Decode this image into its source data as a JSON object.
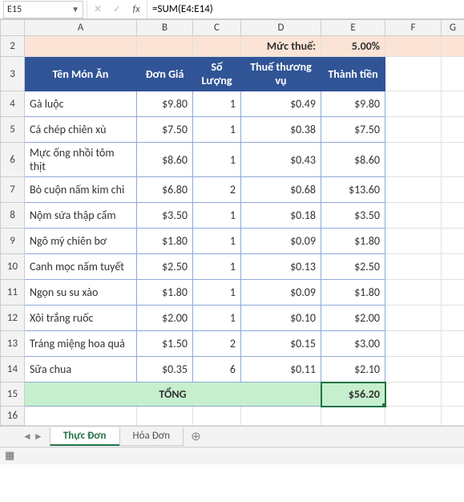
{
  "nameBox": "E15",
  "formula": "=SUM(E4:E14)",
  "columns": [
    "A",
    "B",
    "C",
    "D",
    "E",
    "F",
    "G"
  ],
  "rowNumbers": [
    2,
    3,
    4,
    5,
    6,
    7,
    8,
    9,
    10,
    11,
    12,
    13,
    14,
    15,
    16
  ],
  "taxRow": {
    "label": "Mức thuế:",
    "value": "5.00%"
  },
  "headers": {
    "name": "Tên Món Ăn",
    "price": "Đơn Giá",
    "qty": "Số Lượng",
    "tax": "Thuế thương vụ",
    "total": "Thành tiền"
  },
  "rows": [
    {
      "name": "Gà luộc",
      "price": "$9.80",
      "qty": "1",
      "tax": "$0.49",
      "total": "$9.80"
    },
    {
      "name": "Cá chép chiên xù",
      "price": "$7.50",
      "qty": "1",
      "tax": "$0.38",
      "total": "$7.50"
    },
    {
      "name": "Mực ống nhồi tôm thịt",
      "price": "$8.60",
      "qty": "1",
      "tax": "$0.43",
      "total": "$8.60"
    },
    {
      "name": "Bò cuộn nấm kim chi",
      "price": "$6.80",
      "qty": "2",
      "tax": "$0.68",
      "total": "$13.60"
    },
    {
      "name": "Nộm sứa thập cẩm",
      "price": "$3.50",
      "qty": "1",
      "tax": "$0.18",
      "total": "$3.50"
    },
    {
      "name": "Ngô mỹ chiên bơ",
      "price": "$1.80",
      "qty": "1",
      "tax": "$0.09",
      "total": "$1.80"
    },
    {
      "name": "Canh mọc nấm tuyết",
      "price": "$2.50",
      "qty": "1",
      "tax": "$0.13",
      "total": "$2.50"
    },
    {
      "name": "Ngọn su su xào",
      "price": "$1.80",
      "qty": "1",
      "tax": "$0.09",
      "total": "$1.80"
    },
    {
      "name": "Xôi trắng ruốc",
      "price": "$2.00",
      "qty": "1",
      "tax": "$0.10",
      "total": "$2.00"
    },
    {
      "name": "Tráng miệng hoa quả",
      "price": "$1.50",
      "qty": "2",
      "tax": "$0.15",
      "total": "$3.00"
    },
    {
      "name": "Sữa chua",
      "price": "$0.35",
      "qty": "6",
      "tax": "$0.11",
      "total": "$2.10"
    }
  ],
  "totalRow": {
    "label": "TỔNG",
    "value": "$56.20"
  },
  "tabs": [
    {
      "label": "Thực Đơn",
      "active": true
    },
    {
      "label": "Hóa Đơn",
      "active": false
    }
  ],
  "chart_data": {
    "type": "table",
    "title": "Thực Đơn",
    "tax_rate_percent": 5.0,
    "columns": [
      "Tên Món Ăn",
      "Đơn Giá",
      "Số Lượng",
      "Thuế thương vụ",
      "Thành tiền"
    ],
    "rows": [
      [
        "Gà luộc",
        9.8,
        1,
        0.49,
        9.8
      ],
      [
        "Cá chép chiên xù",
        7.5,
        1,
        0.38,
        7.5
      ],
      [
        "Mực ống nhồi tôm thịt",
        8.6,
        1,
        0.43,
        8.6
      ],
      [
        "Bò cuộn nấm kim chi",
        6.8,
        2,
        0.68,
        13.6
      ],
      [
        "Nộm sứa thập cẩm",
        3.5,
        1,
        0.18,
        3.5
      ],
      [
        "Ngô mỹ chiên bơ",
        1.8,
        1,
        0.09,
        1.8
      ],
      [
        "Canh mọc nấm tuyết",
        2.5,
        1,
        0.13,
        2.5
      ],
      [
        "Ngọn su su xào",
        1.8,
        1,
        0.09,
        1.8
      ],
      [
        "Xôi trắng ruốc",
        2.0,
        1,
        0.1,
        2.0
      ],
      [
        "Tráng miệng hoa quả",
        1.5,
        2,
        0.15,
        3.0
      ],
      [
        "Sữa chua",
        0.35,
        6,
        0.11,
        2.1
      ]
    ],
    "grand_total": 56.2
  }
}
